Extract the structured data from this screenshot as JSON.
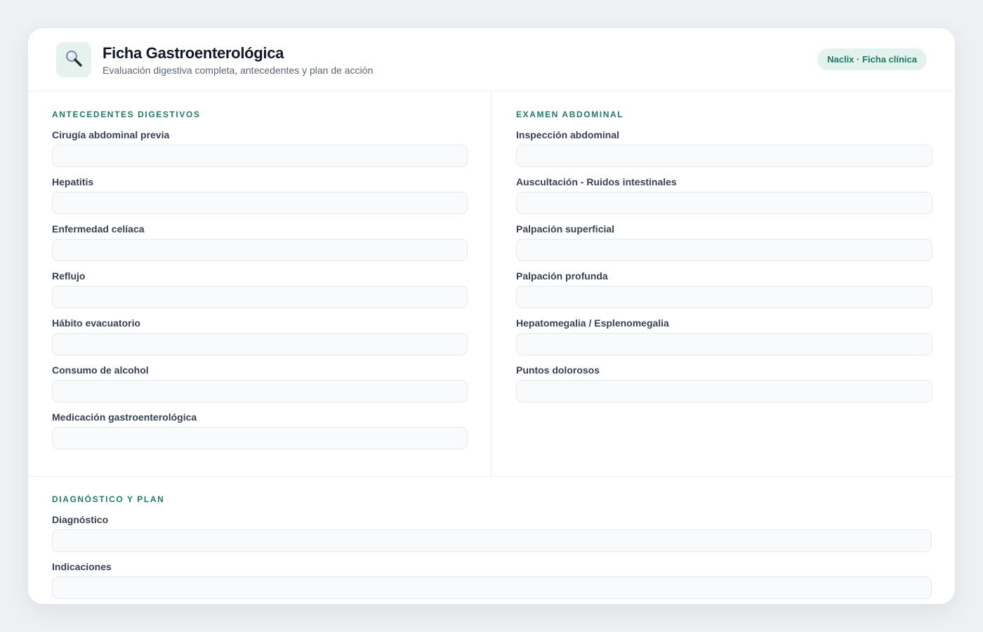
{
  "header": {
    "icon": "magnifier-icon",
    "title": "Ficha Gastroenterológica",
    "subtitle": "Evaluación digestiva completa, antecedentes y plan de acción",
    "badge": "Naclix · Ficha clínica"
  },
  "left": {
    "section_title": "ANTECEDENTES DIGESTIVOS",
    "fields": [
      {
        "label": "Cirugía abdominal previa",
        "value": ""
      },
      {
        "label": "Hepatitis",
        "value": ""
      },
      {
        "label": "Enfermedad celíaca",
        "value": ""
      },
      {
        "label": "Reflujo",
        "value": ""
      },
      {
        "label": "Hábito evacuatorio",
        "value": ""
      },
      {
        "label": "Consumo de alcohol",
        "value": ""
      },
      {
        "label": "Medicación gastroenterológica",
        "value": ""
      }
    ]
  },
  "right": {
    "section_title": "EXAMEN ABDOMINAL",
    "fields": [
      {
        "label": "Inspección abdominal",
        "value": ""
      },
      {
        "label": "Auscultación - Ruidos intestinales",
        "value": ""
      },
      {
        "label": "Palpación superficial",
        "value": ""
      },
      {
        "label": "Palpación profunda",
        "value": ""
      },
      {
        "label": "Hepatomegalia / Esplenomegalia",
        "value": ""
      },
      {
        "label": "Puntos dolorosos",
        "value": ""
      }
    ]
  },
  "bottom": {
    "section_title": "DIAGNÓSTICO Y PLAN",
    "fields": [
      {
        "label": "Diagnóstico",
        "value": ""
      },
      {
        "label": "Indicaciones",
        "value": ""
      }
    ]
  },
  "colors": {
    "accent": "#237a67",
    "badge_bg": "#e3f2ed",
    "logo_bg": "#e5f2ee"
  }
}
